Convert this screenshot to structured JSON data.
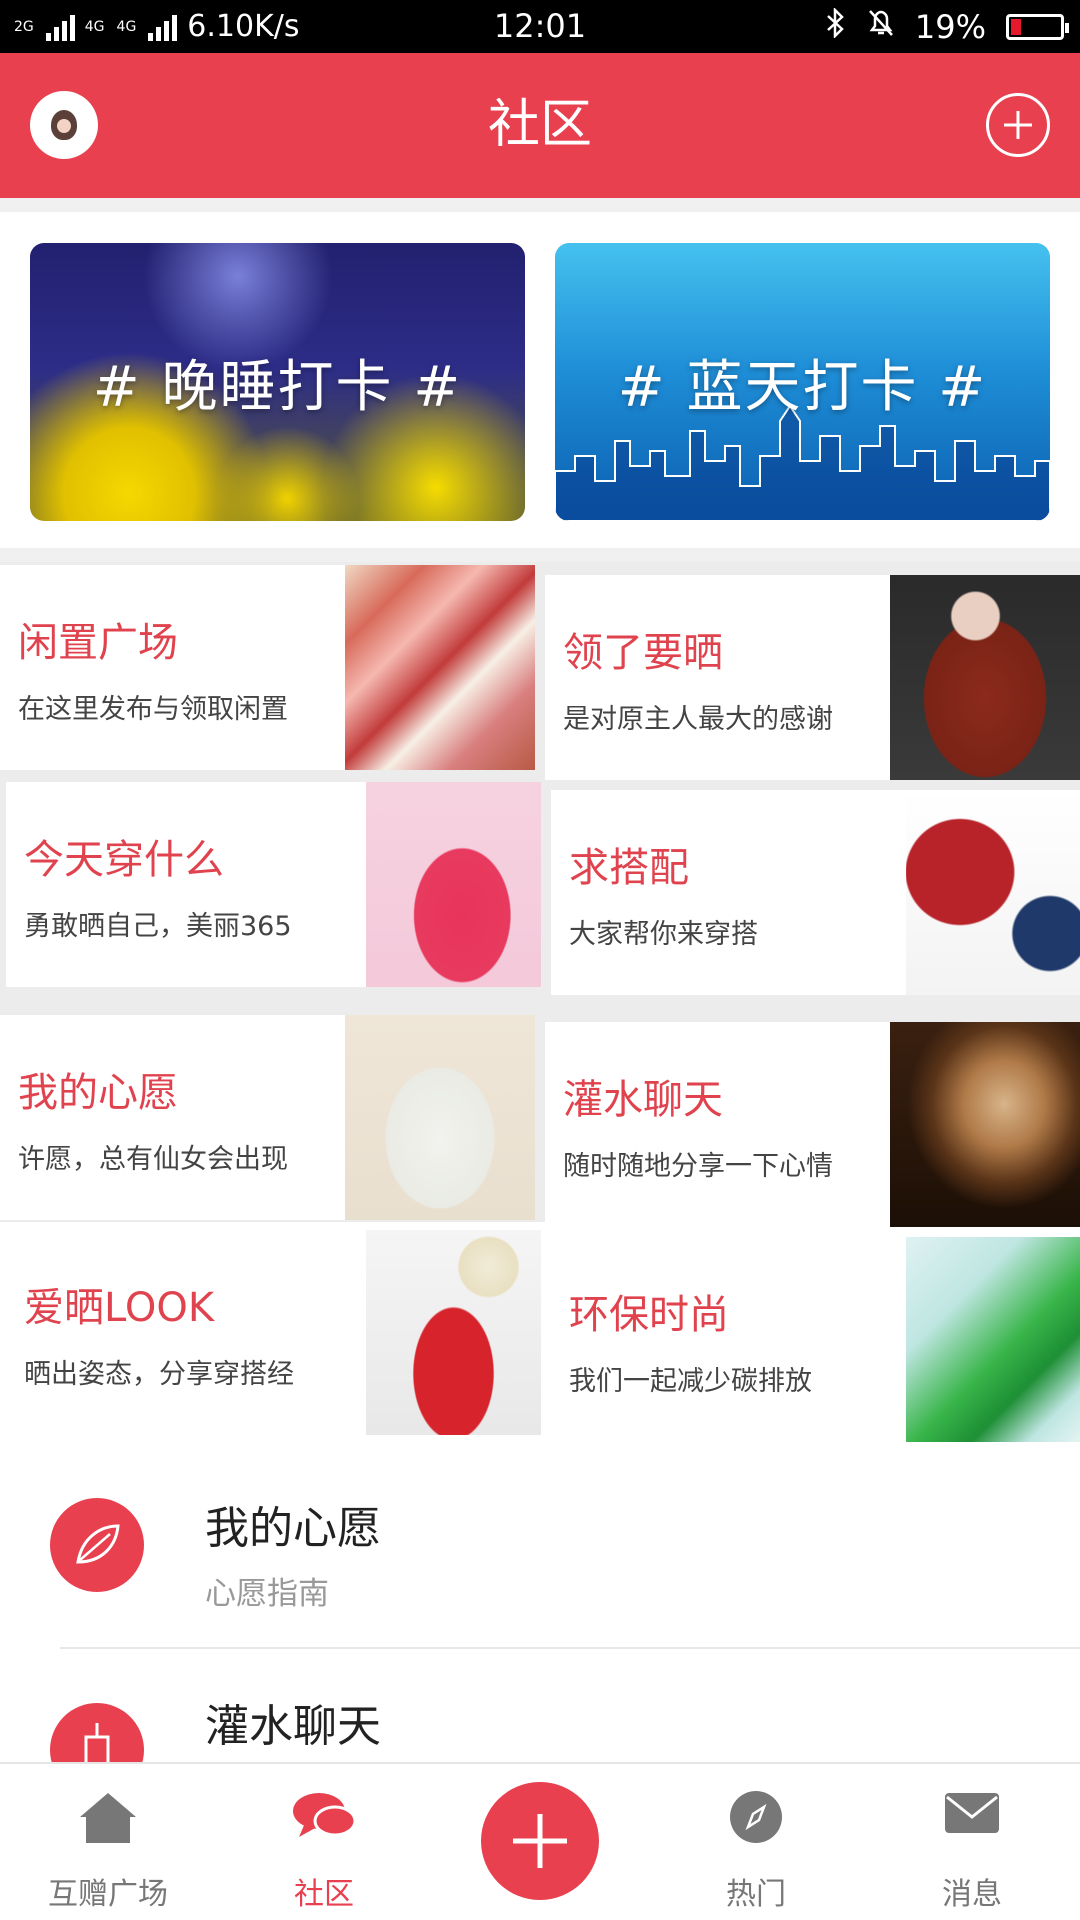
{
  "status_bar": {
    "network1": "2G",
    "network2": "4G",
    "network3": "4G",
    "speed": "6.10K/s",
    "time": "12:01",
    "battery": "19%",
    "battery_level": 0.19
  },
  "header": {
    "title": "社区",
    "avatar_icon": "avatar-girl-icon",
    "add_icon": "plus-circle-icon"
  },
  "banners": [
    {
      "text": "# 晚睡打卡 #"
    },
    {
      "text": "# 蓝天打卡 #"
    }
  ],
  "categories": [
    {
      "title": "闲置广场",
      "subtitle": "在这里发布与领取闲置"
    },
    {
      "title": "领了要晒",
      "subtitle": "是对原主人最大的感谢"
    },
    {
      "title": "今天穿什么",
      "subtitle": "勇敢晒自己，美丽365"
    },
    {
      "title": "求搭配",
      "subtitle": "大家帮你来穿搭"
    },
    {
      "title": "我的心愿",
      "subtitle": "许愿，总有仙女会出现"
    },
    {
      "title": "灌水聊天",
      "subtitle": "随时随地分享一下心情"
    },
    {
      "title": "爱晒LOOK",
      "subtitle": "晒出姿态，分享穿搭经"
    },
    {
      "title": "环保时尚",
      "subtitle": "我们一起减少碳排放"
    }
  ],
  "list": [
    {
      "title": "我的心愿",
      "subtitle": "心愿指南",
      "icon": "leaf-icon"
    },
    {
      "title": "灌水聊天",
      "subtitle": "",
      "icon": "cup-icon"
    }
  ],
  "bottom_nav": [
    {
      "label": "互赠广场",
      "icon": "home-icon"
    },
    {
      "label": "社区",
      "icon": "chat-icon"
    },
    {
      "label": "",
      "icon": "plus-icon"
    },
    {
      "label": "热门",
      "icon": "compass-icon"
    },
    {
      "label": "消息",
      "icon": "mail-icon"
    }
  ],
  "colors": {
    "accent": "#e8404f",
    "title_red": "#e0434e"
  }
}
